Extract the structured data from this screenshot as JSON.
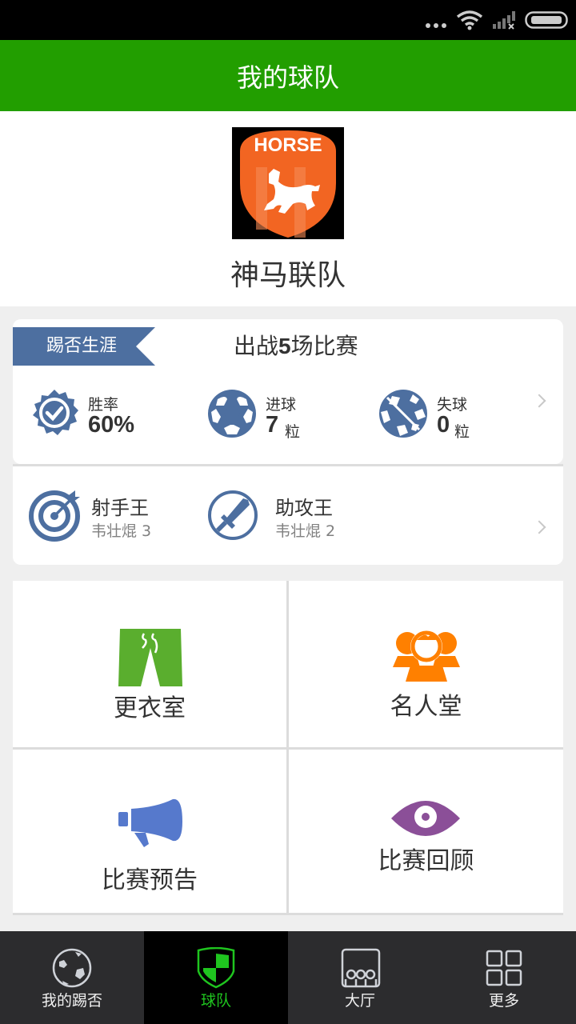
{
  "status_bar": {
    "icons": [
      "more-dots-icon",
      "wifi-icon",
      "signal-no-sim-icon",
      "battery-icon"
    ]
  },
  "header": {
    "title": "我的球队"
  },
  "team": {
    "name": "神马联队",
    "logo_text": "HORSE",
    "logo_colors": {
      "shield": "#f26522",
      "background": "#000000"
    }
  },
  "career": {
    "ribbon_label": "踢否生涯",
    "matches_prefix": "出战",
    "matches_count": "5",
    "matches_suffix": "场比赛",
    "stats": [
      {
        "icon": "badge-check-icon",
        "label": "胜率",
        "value": "60%",
        "unit": ""
      },
      {
        "icon": "soccer-ball-icon",
        "label": "进球",
        "value": "7",
        "unit": "粒"
      },
      {
        "icon": "soccer-ball-conceded-icon",
        "label": "失球",
        "value": "0",
        "unit": "粒"
      }
    ]
  },
  "leaders": [
    {
      "icon": "target-icon",
      "title": "射手王",
      "player": "韦壮焜 3"
    },
    {
      "icon": "sword-icon",
      "title": "助攻王",
      "player": "韦壮焜 2"
    }
  ],
  "menu": [
    {
      "icon": "shorts-icon",
      "label": "更衣室",
      "color": "#5aae2e"
    },
    {
      "icon": "people-icon",
      "label": "名人堂",
      "color": "#ff8000"
    },
    {
      "icon": "megaphone-icon",
      "label": "比赛预告",
      "color": "#5679cc"
    },
    {
      "icon": "eye-icon",
      "label": "比赛回顾",
      "color": "#8b4f98"
    }
  ],
  "tabs": [
    {
      "icon": "soccer-ball-icon",
      "label": "我的踢否",
      "active": false
    },
    {
      "icon": "shield-icon",
      "label": "球队",
      "active": true
    },
    {
      "icon": "hall-icon",
      "label": "大厅",
      "active": false
    },
    {
      "icon": "grid-icon",
      "label": "更多",
      "active": false
    }
  ],
  "colors": {
    "brand_green": "#229e00",
    "accent_blue": "#4d6fa0",
    "active_tab_green": "#1fc51f"
  }
}
